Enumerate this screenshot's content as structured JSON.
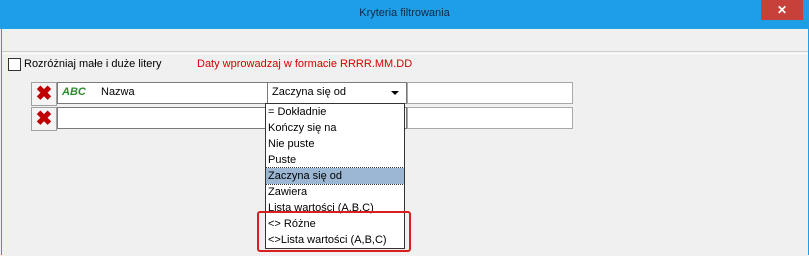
{
  "window": {
    "title": "Kryteria filtrowania",
    "close_icon": "✕"
  },
  "options": {
    "case_sensitive_label": "Rozróżniaj małe i duże litery",
    "case_sensitive_checked": false
  },
  "hint": {
    "text": "Daty wprowadzaj w formacie RRRR.MM.DD"
  },
  "rows": [
    {
      "delete_icon": "✖",
      "field_icon_text": "ABC",
      "field": "Nazwa",
      "operator": "Zaczyna się od",
      "value": ""
    },
    {
      "delete_icon": "✖",
      "field_icon_text": "",
      "field": "",
      "operator": "",
      "value": ""
    }
  ],
  "dropdown": {
    "selected": "Zaczyna się od",
    "items": [
      "= Dokładnie",
      "Kończy się na",
      "Nie puste",
      "Puste",
      "Zaczyna się od",
      "Zawiera",
      "Lista wartości (A,B,C)",
      "<> Różne",
      "<>Lista wartości (A,B,C)"
    ]
  },
  "colors": {
    "titlebar": "#1f9ee8",
    "close": "#c7403a",
    "hint": "#d40000",
    "highlight": "#d81e1e",
    "selection": "#9bb7d4"
  }
}
